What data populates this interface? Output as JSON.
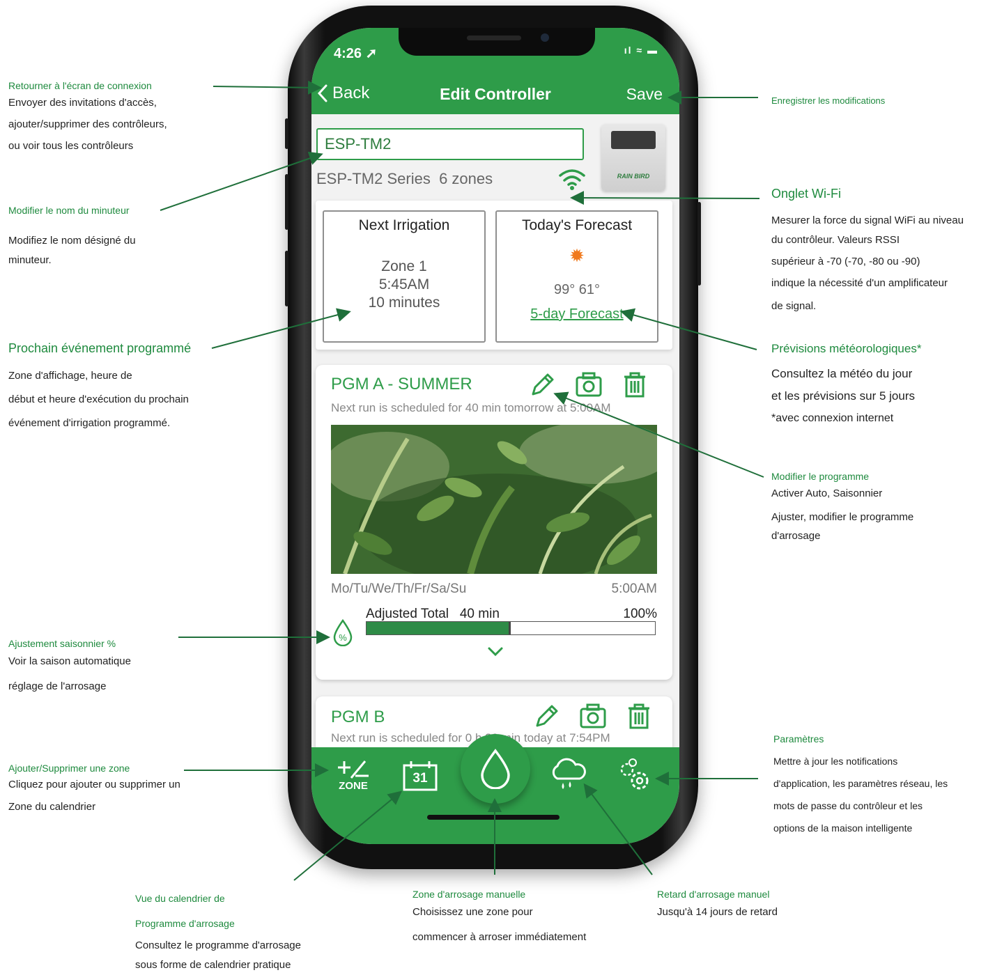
{
  "phone": {
    "status_time": "4:26",
    "status_icons": "ıl ≈ ▬",
    "nav": {
      "back_label": "Back",
      "title": "Edit Controller",
      "save_label": "Save"
    },
    "controller": {
      "name_value": "ESP-TM2",
      "series": "ESP-TM2 Series",
      "zones": "6 zones",
      "image_logo": "RAIN BIRD"
    },
    "next_irrigation": {
      "heading": "Next Irrigation",
      "zone": "Zone 1",
      "time": "5:45AM",
      "duration": "10 minutes"
    },
    "forecast": {
      "heading": "Today's Forecast",
      "temps": "99° 61°",
      "link": "5-day Forecast"
    },
    "programs": [
      {
        "title": "PGM A - SUMMER",
        "subtitle": "Next run is scheduled for 40 min tomorrow at 5:00AM",
        "days": "Mo/Tu/We/Th/Fr/Sa/Su",
        "time": "5:00AM",
        "adjusted_label": "Adjusted Total",
        "adjusted_value": "40 min",
        "seasonal_percent": "100%",
        "bar_fill_fraction": 0.5
      },
      {
        "title": "PGM B",
        "subtitle": "Next run is scheduled for 0 h 30 min today at 7:54PM"
      }
    ],
    "bottom_nav": {
      "zone_label": "ZONE",
      "calendar_day": "31"
    },
    "colors": {
      "brand_green": "#2e9c49",
      "accent_green": "#1e8a3e"
    }
  },
  "annotations": {
    "back": {
      "title": "Retourner à l'écran de connexion",
      "lines": [
        "Envoyer des invitations d'accès,",
        "ajouter/supprimer des contrôleurs,",
        "ou voir tous les contrôleurs"
      ]
    },
    "rename": {
      "title": "Modifier le nom du minuteur",
      "lines": [
        "Modifiez le nom désigné du",
        "minuteur."
      ]
    },
    "next_event": {
      "title": "Prochain événement programmé",
      "lines": [
        "Zone d'affichage, heure de",
        "début et heure d'exécution du prochain",
        "événement d'irrigation programmé."
      ]
    },
    "seasonal": {
      "title": "Ajustement saisonnier %",
      "lines": [
        "Voir la saison automatique",
        "réglage de l'arrosage"
      ]
    },
    "zone": {
      "title": "Ajouter/Supprimer une zone",
      "lines": [
        "Cliquez pour ajouter ou supprimer un",
        "Zone du calendrier"
      ]
    },
    "calendar": {
      "title1": "Vue du calendrier de",
      "title2": "Programme d'arrosage",
      "lines": [
        "Consultez le programme d'arrosage",
        "sous forme de calendrier pratique"
      ]
    },
    "manual": {
      "title": "Zone d'arrosage manuelle",
      "lines": [
        "Choisissez une zone pour",
        "commencer à arroser immédiatement"
      ]
    },
    "delay": {
      "title": "Retard d'arrosage manuel",
      "lines": [
        "Jusqu'à 14 jours de retard"
      ]
    },
    "save": {
      "title": "Enregistrer les modifications"
    },
    "wifi": {
      "title": "Onglet Wi-Fi",
      "lines": [
        "Mesurer la force du signal WiFi au niveau",
        "du contrôleur. Valeurs RSSI",
        "supérieur à -70 (-70, -80 ou -90)",
        "indique la nécessité d'un amplificateur",
        "de signal."
      ]
    },
    "weather": {
      "title": "Prévisions météorologiques*",
      "lines": [
        "Consultez la météo du jour",
        "et les prévisions sur 5 jours",
        "*avec connexion internet"
      ]
    },
    "program": {
      "title": "Modifier le programme",
      "lines": [
        "Activer Auto, Saisonnier",
        "Ajuster, modifier le programme",
        "d'arrosage"
      ]
    },
    "settings": {
      "title": "Paramètres",
      "lines": [
        "Mettre à jour les notifications",
        "d'application, les paramètres réseau, les",
        "mots de passe du contrôleur et les",
        "options de la maison intelligente"
      ]
    }
  }
}
